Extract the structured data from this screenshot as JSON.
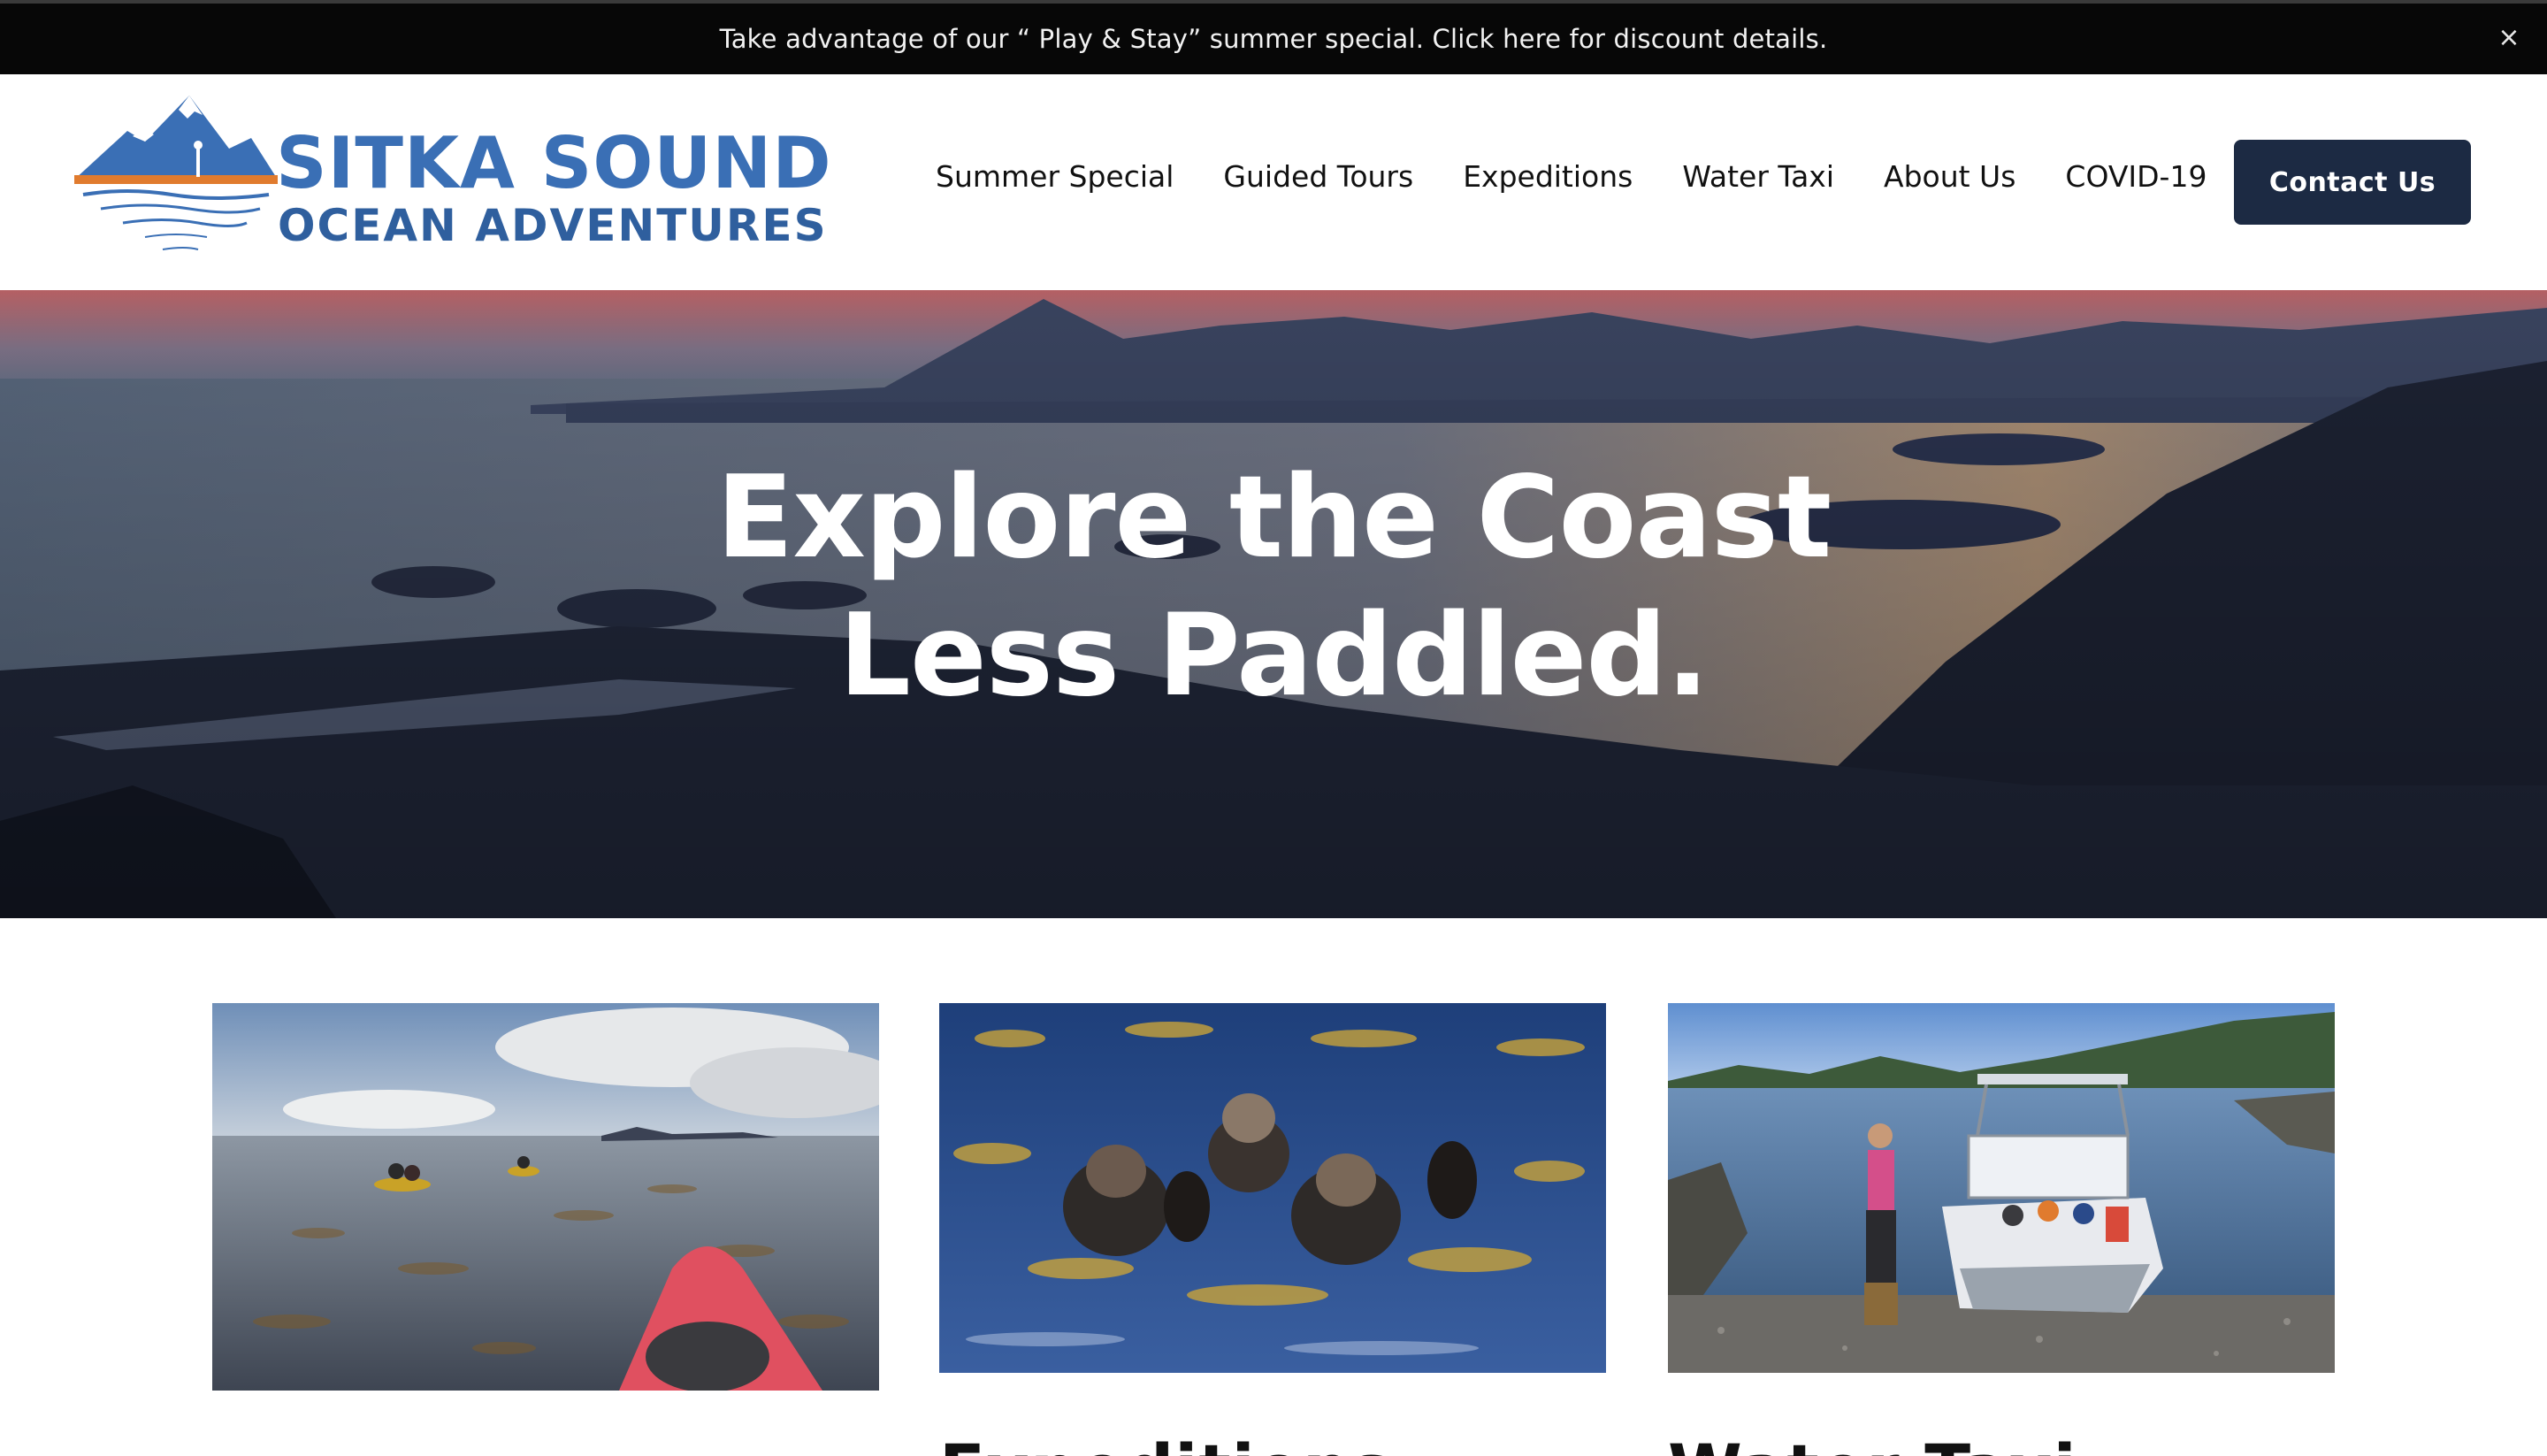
{
  "announcement": {
    "text": "Take advantage of our “ Play & Stay” summer special. Click here for discount details.",
    "close_icon": "×"
  },
  "brand": {
    "name_line1": "SITKA SOUND",
    "name_line2": "OCEAN ADVENTURES",
    "primary_color": "#3a6fb5",
    "accent_color": "#e07b2e"
  },
  "nav": {
    "items": [
      {
        "label": "Summer Special"
      },
      {
        "label": "Guided Tours"
      },
      {
        "label": "Expeditions"
      },
      {
        "label": "Water Taxi"
      },
      {
        "label": "About Us"
      },
      {
        "label": "COVID-19"
      }
    ],
    "cta_label": "Contact Us",
    "cta_color": "#1c2a43"
  },
  "hero": {
    "title_line1": "Explore the Coast",
    "title_line2": "Less Paddled."
  },
  "cards": [
    {
      "image": "kayakers-in-kelp-photo",
      "title": ""
    },
    {
      "image": "sea-otters-photo",
      "title": "Expeditions"
    },
    {
      "image": "water-taxi-boat-photo",
      "title": "Water Taxi"
    }
  ]
}
